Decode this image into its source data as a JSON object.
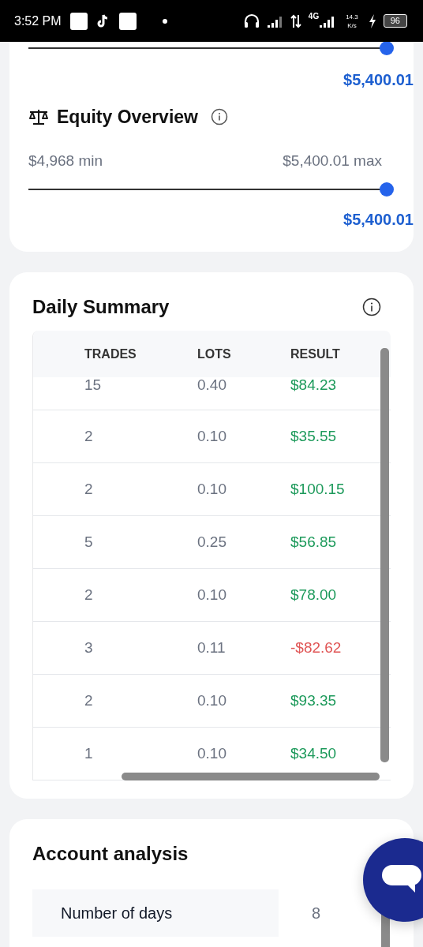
{
  "status_bar": {
    "time": "3:52 PM",
    "network": "4G",
    "speed": "14.3",
    "speed_unit": "K/s",
    "battery": "96"
  },
  "balance_slider": {
    "level": 1,
    "value": "$5,400.01"
  },
  "equity_overview": {
    "title": "Equity Overview",
    "min": "$4,968 min",
    "max": "$5,400.01 max",
    "level": 1,
    "value": "$5,400.01"
  },
  "daily_summary": {
    "title": "Daily Summary",
    "columns": [
      "TRADES",
      "LOTS",
      "RESULT"
    ],
    "rows": [
      {
        "trades": "15",
        "lots": "0.40",
        "result": "$84.23",
        "kind": "profit"
      },
      {
        "trades": "2",
        "lots": "0.10",
        "result": "$35.55",
        "kind": "profit"
      },
      {
        "trades": "2",
        "lots": "0.10",
        "result": "$100.15",
        "kind": "profit"
      },
      {
        "trades": "5",
        "lots": "0.25",
        "result": "$56.85",
        "kind": "profit"
      },
      {
        "trades": "2",
        "lots": "0.10",
        "result": "$78.00",
        "kind": "profit"
      },
      {
        "trades": "3",
        "lots": "0.11",
        "result": "-$82.62",
        "kind": "loss"
      },
      {
        "trades": "2",
        "lots": "0.10",
        "result": "$93.35",
        "kind": "profit"
      },
      {
        "trades": "1",
        "lots": "0.10",
        "result": "$34.50",
        "kind": "profit"
      }
    ]
  },
  "account_analysis": {
    "title": "Account analysis",
    "rows": [
      {
        "label": "Number of days",
        "value": "8"
      }
    ]
  }
}
